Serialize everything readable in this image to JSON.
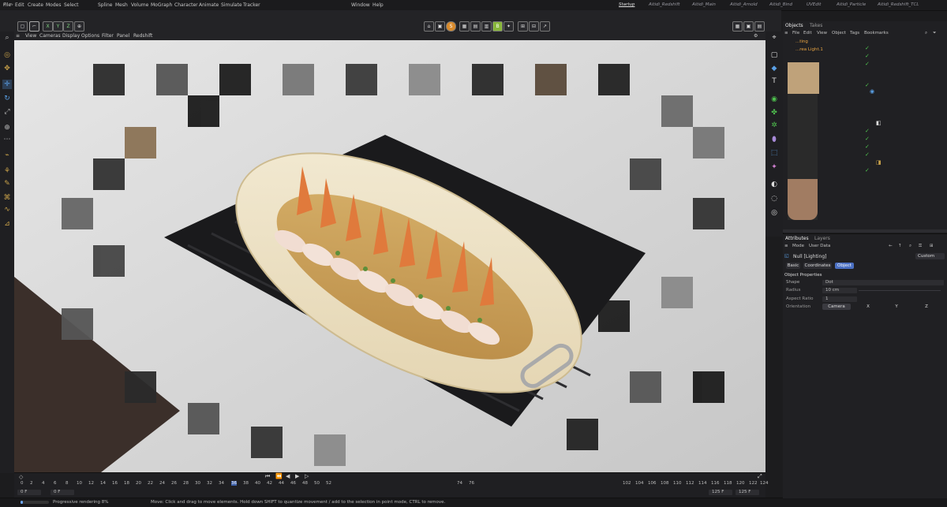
{
  "menubar": {
    "items": [
      "File",
      "Edit",
      "Create",
      "Modes",
      "Select",
      "Spline",
      "Mesh",
      "Volume",
      "MoGraph",
      "Character",
      "Animate",
      "Simulate",
      "Tracker",
      "Window",
      "Help"
    ],
    "layouts": [
      "Startup",
      "Aitidi_Redshift",
      "Aitidi_Main",
      "Aitidi_Arnold",
      "Aitidi_Bind",
      "UVEdit",
      "Aitidi_Particle",
      "Aitidi_Redshift_TCL"
    ]
  },
  "toolbar": {
    "axes": [
      "X",
      "Y",
      "Z"
    ]
  },
  "viewport": {
    "menu": [
      "View",
      "Cameras",
      "Display",
      "Options",
      "Filter",
      "Panel",
      "Redshift"
    ]
  },
  "objects": {
    "tabs": [
      "Objects",
      "Takes"
    ],
    "menu": [
      "File",
      "Edit",
      "View",
      "Object",
      "Tags",
      "Bookmarks"
    ],
    "rows": [
      "...ting",
      "...rea Light.1"
    ]
  },
  "attributes": {
    "tabs": [
      "Attributes",
      "Layers"
    ],
    "menu": [
      "Mode",
      "User Data"
    ],
    "object_title": "Null [Lighting]",
    "preset": "Custom",
    "subtabs": [
      "Basic",
      "Coordinates",
      "Object"
    ],
    "section": "Object Properties",
    "props": {
      "shape_label": "Shape",
      "shape_value": "Dot",
      "radius_label": "Radius",
      "radius_value": "10 cm",
      "aspect_label": "Aspect Ratio",
      "aspect_value": "1",
      "orientation_label": "Orientation",
      "orientation_value": "Camera",
      "axes": [
        "X",
        "Y",
        "Z"
      ]
    }
  },
  "timeline": {
    "ticks_left": [
      "0",
      "2",
      "4",
      "6",
      "8",
      "10",
      "12",
      "14",
      "16",
      "18",
      "20",
      "22",
      "24",
      "26",
      "28",
      "30",
      "32",
      "34",
      "36",
      "38",
      "40",
      "42",
      "44",
      "46",
      "48",
      "50",
      "52"
    ],
    "ticks_right": [
      "74",
      "76",
      "102",
      "104",
      "106",
      "108",
      "110",
      "112",
      "114",
      "116",
      "118",
      "120",
      "122",
      "124"
    ],
    "current_frame": "0 F",
    "start_frame": "0 F",
    "end_frame": "125 F",
    "end_frame2": "125 F"
  },
  "status": {
    "progress": "Progressive rendering 8%",
    "progress_fraction": 0.08,
    "hint": "Move: Click and drag to move elements. Hold down SHIFT to quantize movement / add to the selection in point mode, CTRL to remove."
  }
}
